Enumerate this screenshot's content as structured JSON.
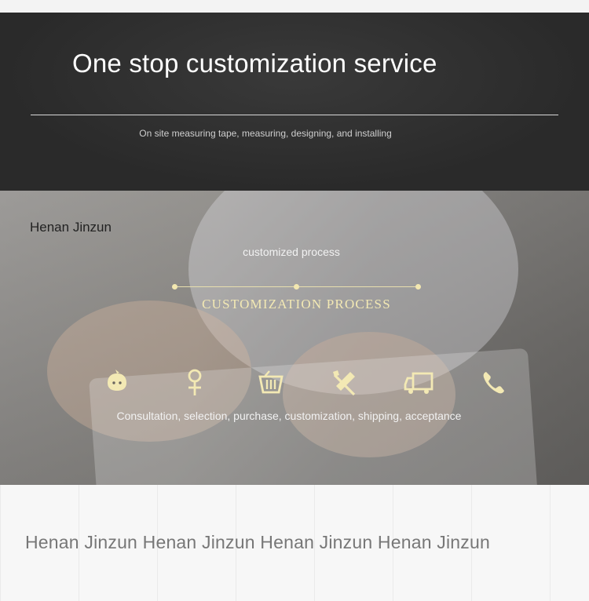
{
  "header": {
    "title": "One stop customization service",
    "subtitle": "On site measuring tape, measuring, designing, and installing"
  },
  "process": {
    "brand": "Henan Jinzun",
    "subtitle": "customized process",
    "title": "CUSTOMIZATION PROCESS",
    "steps_text": "Consultation, selection, purchase, customization, shipping, acceptance",
    "icons": [
      "chat-bubble-icon",
      "person-icon",
      "basket-icon",
      "tools-icon",
      "truck-icon",
      "phone-icon"
    ],
    "accent_color": "#f3e9b4"
  },
  "footer": {
    "repeat_text": "Henan Jinzun Henan Jinzun Henan Jinzun Henan Jinzun"
  }
}
